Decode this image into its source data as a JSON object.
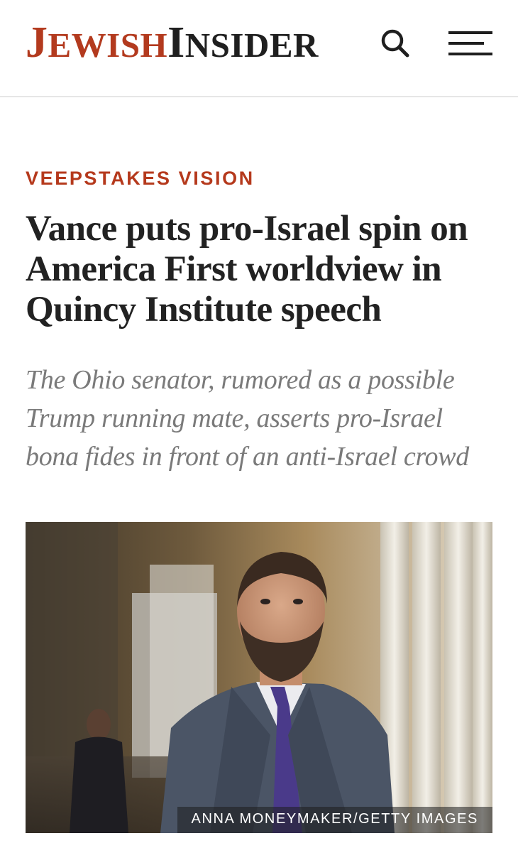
{
  "header": {
    "logo_first_initial": "J",
    "logo_first_rest": "EWISH",
    "logo_second_initial": "I",
    "logo_second_rest": "NSIDER",
    "search_icon": "search-icon",
    "menu_icon": "hamburger-menu-icon",
    "brand_color": "#b33a1e"
  },
  "article": {
    "kicker": "VEEPSTAKES VISION",
    "kicker_color": "#b5391c",
    "headline": "Vance puts pro-Israel spin on America First worldview in Quincy Institute speech",
    "dek": "The Ohio senator, rumored as a possible Trump running mate, asserts pro-Israel bona fides in front of an anti-Israel crowd",
    "photo_credit": "ANNA MONEYMAKER/GETTY IMAGES"
  }
}
